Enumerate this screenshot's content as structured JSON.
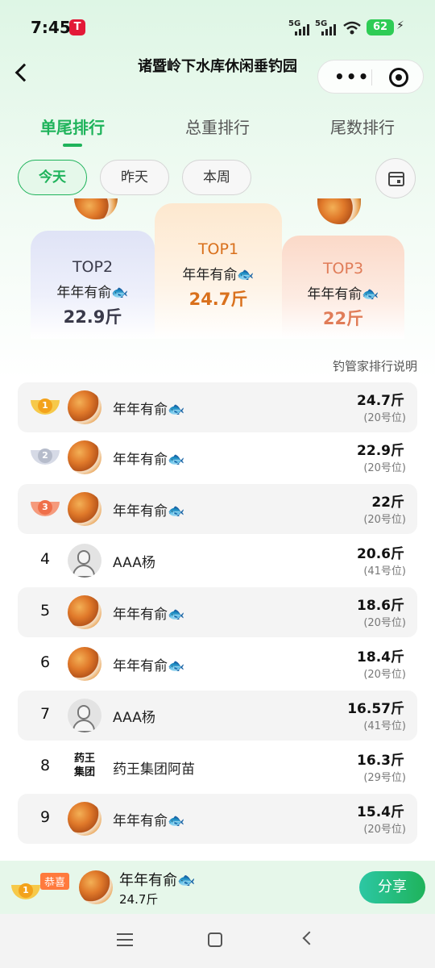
{
  "status_bar": {
    "time": "7:45",
    "sig1": "5G",
    "sig2": "5G",
    "battery": "62"
  },
  "header": {
    "title": "诸暨岭下水库休闲垂钓园"
  },
  "tabs": [
    {
      "label": "单尾排行",
      "active": true
    },
    {
      "label": "总重排行",
      "active": false
    },
    {
      "label": "尾数排行",
      "active": false
    }
  ],
  "filters": [
    {
      "label": "今天",
      "active": true
    },
    {
      "label": "昨天",
      "active": false
    },
    {
      "label": "本周",
      "active": false
    }
  ],
  "podium": {
    "top1": {
      "rank": "TOP1",
      "name": "年年有俞",
      "weight": "24.7斤"
    },
    "top2": {
      "rank": "TOP2",
      "name": "年年有俞",
      "weight": "22.9斤"
    },
    "top3": {
      "rank": "TOP3",
      "name": "年年有俞",
      "weight": "22斤"
    }
  },
  "fish_glyph": "🐟",
  "explain_link": "钓管家排行说明",
  "ranking": [
    {
      "rank": "1",
      "name": "年年有俞",
      "weight": "24.7斤",
      "seat": "(20号位)"
    },
    {
      "rank": "2",
      "name": "年年有俞",
      "weight": "22.9斤",
      "seat": "(20号位)"
    },
    {
      "rank": "3",
      "name": "年年有俞",
      "weight": "22斤",
      "seat": "(20号位)"
    },
    {
      "rank": "4",
      "name": "AAA杨",
      "weight": "20.6斤",
      "seat": "(41号位)"
    },
    {
      "rank": "5",
      "name": "年年有俞",
      "weight": "18.6斤",
      "seat": "(20号位)"
    },
    {
      "rank": "6",
      "name": "年年有俞",
      "weight": "18.4斤",
      "seat": "(20号位)"
    },
    {
      "rank": "7",
      "name": "AAA杨",
      "weight": "16.57斤",
      "seat": "(41号位)"
    },
    {
      "rank": "8",
      "name": "药王集团阿苗",
      "weight": "16.3斤",
      "seat": "(29号位)",
      "logo": [
        "药王",
        "集团"
      ]
    },
    {
      "rank": "9",
      "name": "年年有俞",
      "weight": "15.4斤",
      "seat": "(20号位)"
    }
  ],
  "bottom_bar": {
    "medal": "1",
    "badge": "恭喜",
    "name": "年年有俞",
    "weight": "24.7斤",
    "share": "分享"
  },
  "colors": {
    "accent": "#1fb35b",
    "gold": "#f3a21b",
    "silver": "#b6bccb",
    "bronze": "#ef6f4a",
    "top1": "#d9701c",
    "top2": "#3a3a4a",
    "top3": "#e07c58"
  }
}
